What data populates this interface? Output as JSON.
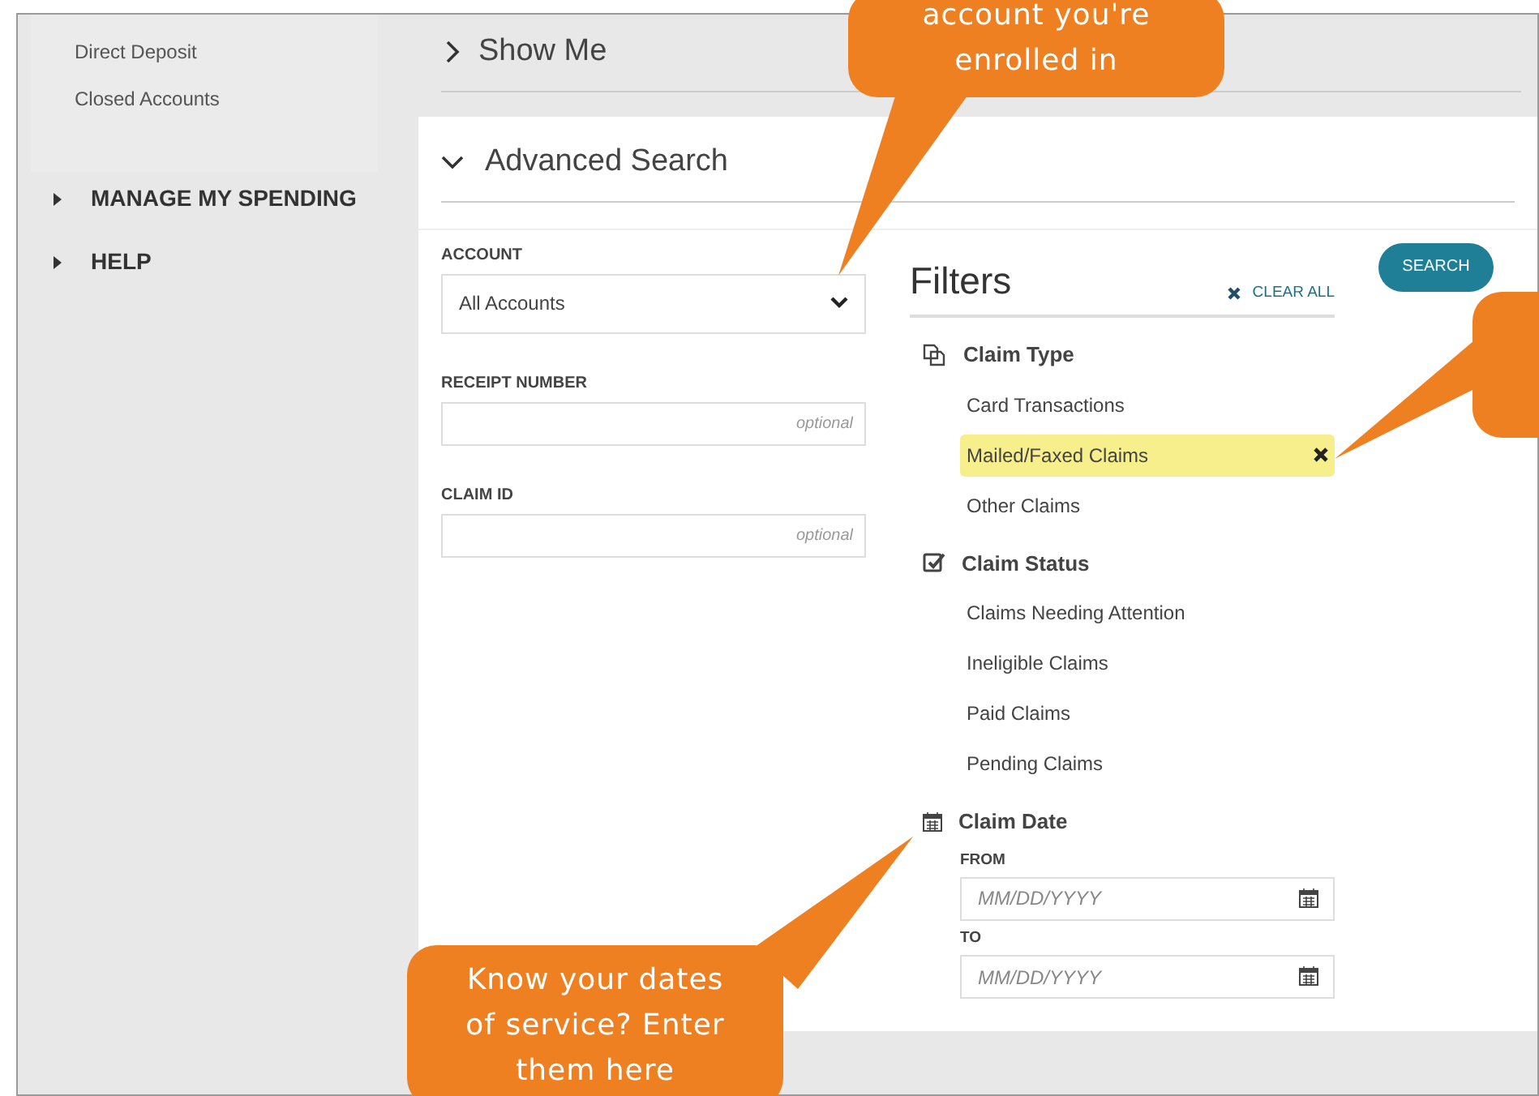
{
  "sidebar": {
    "subitems": [
      "Direct Deposit",
      "Closed Accounts"
    ],
    "menu": [
      {
        "label": "MANAGE MY SPENDING",
        "expanded": false
      },
      {
        "label": "HELP",
        "expanded": false
      }
    ]
  },
  "show_me": {
    "title": "Show Me",
    "expanded": false
  },
  "advanced_search": {
    "title": "Advanced Search",
    "expanded": true,
    "account": {
      "label": "ACCOUNT",
      "value": "All Accounts"
    },
    "fields": [
      {
        "label": "RECEIPT NUMBER",
        "placeholder": "optional"
      },
      {
        "label": "CLAIM ID",
        "placeholder": "optional"
      }
    ],
    "search_button": "SEARCH",
    "filters": {
      "title": "Filters",
      "clear_all": "CLEAR ALL",
      "groups": [
        {
          "title": "Claim Type",
          "kind": "copy",
          "options": [
            {
              "label": "Card Transactions",
              "selected": false
            },
            {
              "label": "Mailed/Faxed Claims",
              "selected": true
            },
            {
              "label": "Other Claims",
              "selected": false
            }
          ]
        },
        {
          "title": "Claim Status",
          "kind": "check",
          "options": [
            {
              "label": "Claims Needing Attention",
              "selected": false
            },
            {
              "label": "Ineligible Claims",
              "selected": false
            },
            {
              "label": "Paid Claims",
              "selected": false
            },
            {
              "label": "Pending Claims",
              "selected": false
            }
          ]
        },
        {
          "title": "Claim Date",
          "kind": "date",
          "dates": [
            {
              "label": "FROM",
              "placeholder": "MM/DD/YYYY"
            },
            {
              "label": "TO",
              "placeholder": "MM/DD/YYYY"
            }
          ]
        }
      ]
    }
  },
  "callouts": [
    "account you're enrolled in",
    "Know your dates of service? Enter them here"
  ]
}
